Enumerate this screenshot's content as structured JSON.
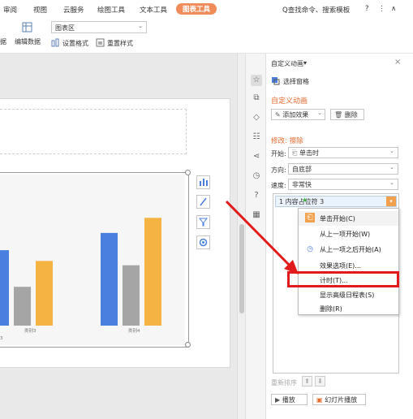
{
  "menubar": {
    "tabs": [
      "审阅",
      "视图",
      "云服务",
      "绘图工具",
      "文本工具",
      "图表工具"
    ],
    "active_tab": "图表工具",
    "search": "Q查找命令、搜索模板",
    "help": "?",
    "more": "⋮",
    "collapse": "∧"
  },
  "ribbon": {
    "left_cut": "据",
    "edit_data": "编辑数据",
    "chart_area_select": "图表区",
    "set_format": "设置格式",
    "reset_style": "重置样式"
  },
  "chart_data": {
    "type": "bar",
    "categories": [
      "类别3",
      "类别4"
    ],
    "category_labels_visible": [
      "3",
      "类别3",
      "类别4"
    ],
    "series": [
      {
        "color": "#4a7fe0",
        "values": [
          3.5,
          4.3
        ]
      },
      {
        "color": "#a5a5a5",
        "values": [
          1.8,
          2.8
        ]
      },
      {
        "color": "#f5b342",
        "values": [
          3.0,
          5.0
        ]
      }
    ],
    "ylim": [
      0,
      5.5
    ]
  },
  "panel": {
    "title": "自定义动画",
    "title_caret": "▾",
    "close": "×",
    "selection_pane": "选择窗格",
    "section_custom": "自定义动画",
    "add_effect": "添加效果",
    "delete": "删除",
    "modify_label": "修改: 擦除",
    "start_label": "开始:",
    "start_value": "单击时",
    "direction_label": "方向:",
    "direction_value": "自底部",
    "speed_label": "速度:",
    "speed_value": "非常快",
    "anim_item": "1  内容占位符 3",
    "reorder_label": "重新排序",
    "play": "播放",
    "slideshow": "幻灯片播放",
    "icon_names": [
      "star-icon",
      "copy-icon",
      "shapes-icon",
      "settings-icon",
      "share-icon",
      "clock-icon",
      "help-icon",
      "grid-icon"
    ]
  },
  "context_menu": {
    "items": [
      "单击开始(C)",
      "从上一项开始(W)",
      "从上一项之后开始(A)",
      "效果选项(E)...",
      "计时(T)...",
      "显示高级日程表(S)",
      "删除(R)"
    ],
    "highlighted": "计时(T)..."
  },
  "colors": {
    "accent_orange": "#f08c5a",
    "highlight_red": "#e11b1b",
    "arrow_red": "#e11b1b"
  }
}
